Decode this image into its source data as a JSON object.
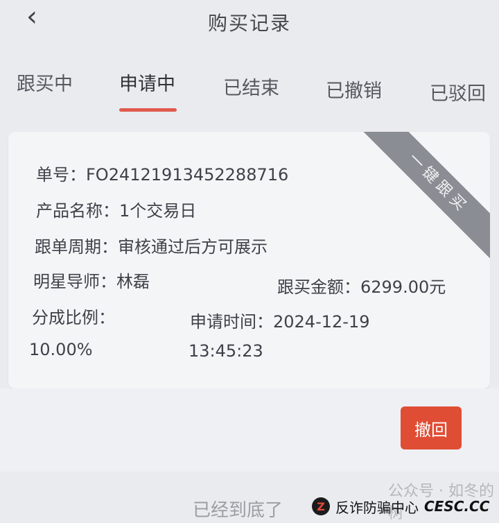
{
  "header": {
    "back_icon": "chevron-left-icon",
    "title": "购买记录"
  },
  "tabs": [
    {
      "label": "跟买中",
      "active": false
    },
    {
      "label": "申请中",
      "active": true
    },
    {
      "label": "已结束",
      "active": false
    },
    {
      "label": "已撤销",
      "active": false
    },
    {
      "label": "已驳回",
      "active": false
    }
  ],
  "order": {
    "ribbon": "一键跟买",
    "number_label": "单号：",
    "number": "FO24121913452288716",
    "product_label": "产品名称：",
    "product": "1个交易日",
    "cycle_label": "跟单周期：",
    "cycle": "审核通过后方可展示",
    "mentor_label": "明星导师：",
    "mentor": "林磊",
    "amount_label": "跟买金额：",
    "amount": "6299.00元",
    "ratio_label": "分成比例：",
    "ratio": "10.00%",
    "time_label": "申请时间：",
    "date": "2024-12-19",
    "time": "13:45:23"
  },
  "actions": {
    "withdraw": "撤回"
  },
  "footer": {
    "end_text": "已经到底了"
  },
  "watermark": {
    "faded": "公众号 · 如冬的树",
    "logo_text": "Z",
    "name": "反诈防骗中心",
    "site": "CESC.CC"
  },
  "colors": {
    "accent": "#e05a4e",
    "button": "#df4d34",
    "ribbon": "#8a8d93",
    "background": "#e9ebef"
  }
}
